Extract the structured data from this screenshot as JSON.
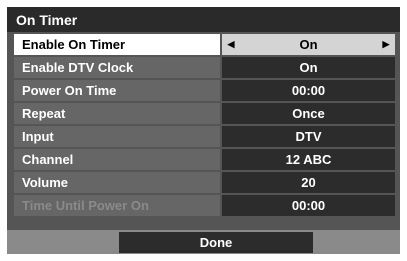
{
  "dialog": {
    "title": "On Timer"
  },
  "settings": [
    {
      "label": "Enable On Timer",
      "value": "On",
      "selected": true,
      "disabled": false,
      "has_arrows": true
    },
    {
      "label": "Enable DTV Clock",
      "value": "On",
      "selected": false,
      "disabled": false,
      "has_arrows": false
    },
    {
      "label": "Power On Time",
      "value": "00:00",
      "selected": false,
      "disabled": false,
      "has_arrows": false
    },
    {
      "label": "Repeat",
      "value": "Once",
      "selected": false,
      "disabled": false,
      "has_arrows": false
    },
    {
      "label": "Input",
      "value": "DTV",
      "selected": false,
      "disabled": false,
      "has_arrows": false
    },
    {
      "label": "Channel",
      "value": "12 ABC",
      "selected": false,
      "disabled": false,
      "has_arrows": false
    },
    {
      "label": "Volume",
      "value": "20",
      "selected": false,
      "disabled": false,
      "has_arrows": false
    },
    {
      "label": "Time Until Power On",
      "value": "00:00",
      "selected": false,
      "disabled": true,
      "has_arrows": false
    }
  ],
  "footer": {
    "done_label": "Done"
  },
  "arrows": {
    "left": "◀",
    "right": "▶"
  },
  "colors": {
    "panel_bg": "#555555",
    "title_bg": "#2a2a2a",
    "label_bg": "#666666",
    "value_bg": "#2c2c2c",
    "selected_label_bg": "#ffffff",
    "selected_value_bg": "#d4d4d4",
    "disabled_text": "#8a8a8a",
    "footer_bg": "#8a8a8a"
  }
}
